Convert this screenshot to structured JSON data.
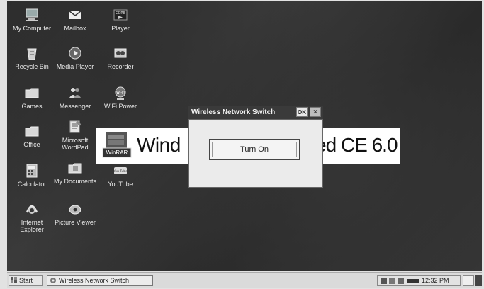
{
  "desktop_icons": [
    {
      "label": "My Computer",
      "icon": "my-computer-icon"
    },
    {
      "label": "Mailbox",
      "icon": "mailbox-icon"
    },
    {
      "label": "Player",
      "icon": "core-player-icon"
    },
    {
      "label": "Recycle Bin",
      "icon": "recycle-bin-icon"
    },
    {
      "label": "Media Player",
      "icon": "media-player-icon"
    },
    {
      "label": "Recorder",
      "icon": "recorder-icon"
    },
    {
      "label": "Games",
      "icon": "folder-icon"
    },
    {
      "label": "Messenger",
      "icon": "messenger-icon"
    },
    {
      "label": "WiFi Power",
      "icon": "wifi-power-icon"
    },
    {
      "label": "Office",
      "icon": "folder-icon"
    },
    {
      "label": "Microsoft WordPad",
      "icon": "wordpad-icon"
    },
    {
      "label": "Calculator",
      "icon": "calculator-icon"
    },
    {
      "label": "My Documents",
      "icon": "folder-icon"
    },
    {
      "label": "YouTube",
      "icon": "youtube-icon"
    },
    {
      "label": "Internet Explorer",
      "icon": "internet-explorer-icon"
    },
    {
      "label": "Picture Viewer",
      "icon": "picture-viewer-icon"
    }
  ],
  "icon_badges": {
    "core_player": "CORE",
    "wifi": "Wi-Fi",
    "youtube": "You Tube"
  },
  "banner": {
    "left_text": "Wind",
    "right_text": "ed CE 6.0",
    "winrar_label": "WinRAR"
  },
  "dialog": {
    "title": "Wireless Network Switch",
    "ok_label": "OK",
    "close_label": "×",
    "button_label": "Turn On"
  },
  "taskbar": {
    "start_label": "Start",
    "task_label": "Wireless Network Switch",
    "clock": "12:32 PM"
  }
}
